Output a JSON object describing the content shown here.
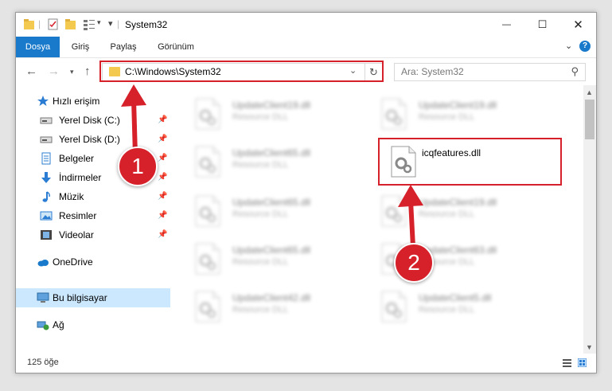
{
  "window": {
    "title": "System32",
    "close_glyph": "✕",
    "max_glyph": "☐",
    "min_glyph": "—"
  },
  "ribbon": {
    "tabs": [
      {
        "label": "Dosya"
      },
      {
        "label": "Giriş"
      },
      {
        "label": "Paylaş"
      },
      {
        "label": "Görünüm"
      }
    ],
    "help_label": "?"
  },
  "navbar": {
    "address_path": "C:\\Windows\\System32",
    "search_placeholder": "Ara: System32"
  },
  "sidebar": {
    "items": [
      {
        "label": "Hızlı erişim",
        "icon": "star-icon"
      },
      {
        "label": "Yerel Disk (C:)",
        "icon": "drive-icon",
        "pinned": true
      },
      {
        "label": "Yerel Disk (D:)",
        "icon": "drive-icon",
        "pinned": true
      },
      {
        "label": "Belgeler",
        "icon": "documents-icon",
        "pinned": true
      },
      {
        "label": "İndirmeler",
        "icon": "download-icon",
        "pinned": true
      },
      {
        "label": "Müzik",
        "icon": "music-icon",
        "pinned": true
      },
      {
        "label": "Resimler",
        "icon": "pictures-icon",
        "pinned": true
      },
      {
        "label": "Videolar",
        "icon": "videos-icon",
        "pinned": true
      },
      {
        "label": "OneDrive",
        "icon": "cloud-icon"
      },
      {
        "label": "Bu bilgisayar",
        "icon": "computer-icon",
        "selected": true
      },
      {
        "label": "Ağ",
        "icon": "network-icon"
      }
    ]
  },
  "files": [
    {
      "name": "UpdateClient19.dll",
      "type": "Resource DLL",
      "blurred": true
    },
    {
      "name": "UpdateClient19.dll",
      "type": "Resource DLL",
      "blurred": true
    },
    {
      "name": "UpdateClient65.dll",
      "type": "Resource DLL",
      "blurred": true
    },
    {
      "name": "icqfeatures.dll",
      "type": "",
      "blurred": false,
      "highlighted": true
    },
    {
      "name": "UpdateClient65.dll",
      "type": "Resource DLL",
      "blurred": true
    },
    {
      "name": "UpdateClient19.dll",
      "type": "Resource DLL",
      "blurred": true
    },
    {
      "name": "UpdateClient65.dll",
      "type": "Resource DLL",
      "blurred": true
    },
    {
      "name": "UpdateClient63.dll",
      "type": "Resource DLL",
      "blurred": true
    },
    {
      "name": "UpdateClient42.dll",
      "type": "Resource DLL",
      "blurred": true
    },
    {
      "name": "UpdateClient5.dll",
      "type": "Resource DLL",
      "blurred": true
    }
  ],
  "status": {
    "item_count": "125 öğe"
  },
  "annotations": {
    "step1": "1",
    "step2": "2",
    "color": "#d6202a"
  },
  "colors": {
    "accent": "#1979ca",
    "selected_bg": "#cce8ff",
    "folder": "#f3c94f"
  }
}
